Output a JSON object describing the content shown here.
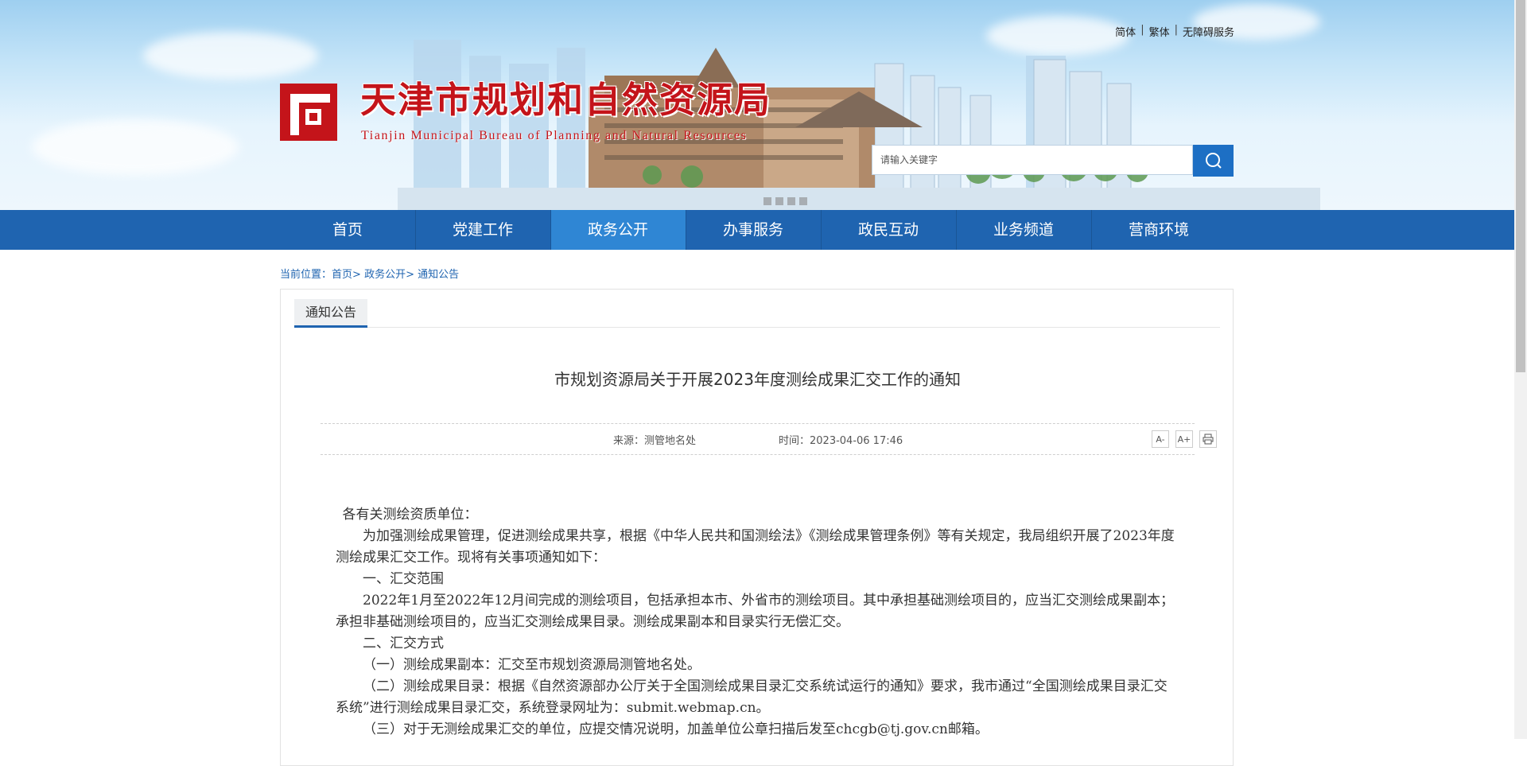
{
  "header": {
    "top_links": [
      {
        "label": "简体"
      },
      {
        "label": "繁体"
      },
      {
        "label": "无障碍服务"
      }
    ],
    "org_name_cn": "天津市规划和自然资源局",
    "org_name_en": "Tianjin Municipal Bureau of Planning and Natural Resources",
    "search": {
      "placeholder": "请输入关键字"
    }
  },
  "nav": {
    "items": [
      {
        "label": "首页"
      },
      {
        "label": "党建工作"
      },
      {
        "label": "政务公开"
      },
      {
        "label": "办事服务"
      },
      {
        "label": "政民互动"
      },
      {
        "label": "业务频道"
      },
      {
        "label": "营商环境"
      }
    ],
    "active": "政务公开"
  },
  "breadcrumb": {
    "prefix": "当前位置：",
    "items": [
      "首页",
      "政务公开",
      "通知公告"
    ],
    "separator": "> "
  },
  "panel": {
    "tab_label": "通知公告",
    "title": "市规划资源局关于开展2023年度测绘成果汇交工作的通知",
    "source": "来源：测管地名处",
    "time": "时间：2023-04-06 17:46",
    "tools": {
      "font_smaller": "A-",
      "font_larger": "A+",
      "print": "print-icon"
    },
    "body": [
      "各有关测绘资质单位：",
      "为加强测绘成果管理，促进测绘成果共享，根据《中华人民共和国测绘法》《测绘成果管理条例》等有关规定，我局组织开展了2023年度测绘成果汇交工作。现将有关事项通知如下：",
      "一、汇交范围",
      "2022年1月至2022年12月间完成的测绘项目，包括承担本市、外省市的测绘项目。其中承担基础测绘项目的，应当汇交测绘成果副本；承担非基础测绘项目的，应当汇交测绘成果目录。测绘成果副本和目录实行无偿汇交。",
      "二、汇交方式",
      "（一）测绘成果副本：汇交至市规划资源局测管地名处。",
      "（二）测绘成果目录：根据《自然资源部办公厅关于全国测绘成果目录汇交系统试运行的通知》要求，我市通过“全国测绘成果目录汇交系统”进行测绘成果目录汇交，系统登录网址为：submit.webmap.cn。",
      "（三）对于无测绘成果汇交的单位，应提交情况说明，加盖单位公章扫描后发至chcgb@tj.gov.cn邮箱。"
    ]
  },
  "colors": {
    "nav_bg": "#1f64b0",
    "nav_active": "#2f86d4",
    "brand_red": "#c4141a",
    "link_blue": "#1f64b0"
  }
}
